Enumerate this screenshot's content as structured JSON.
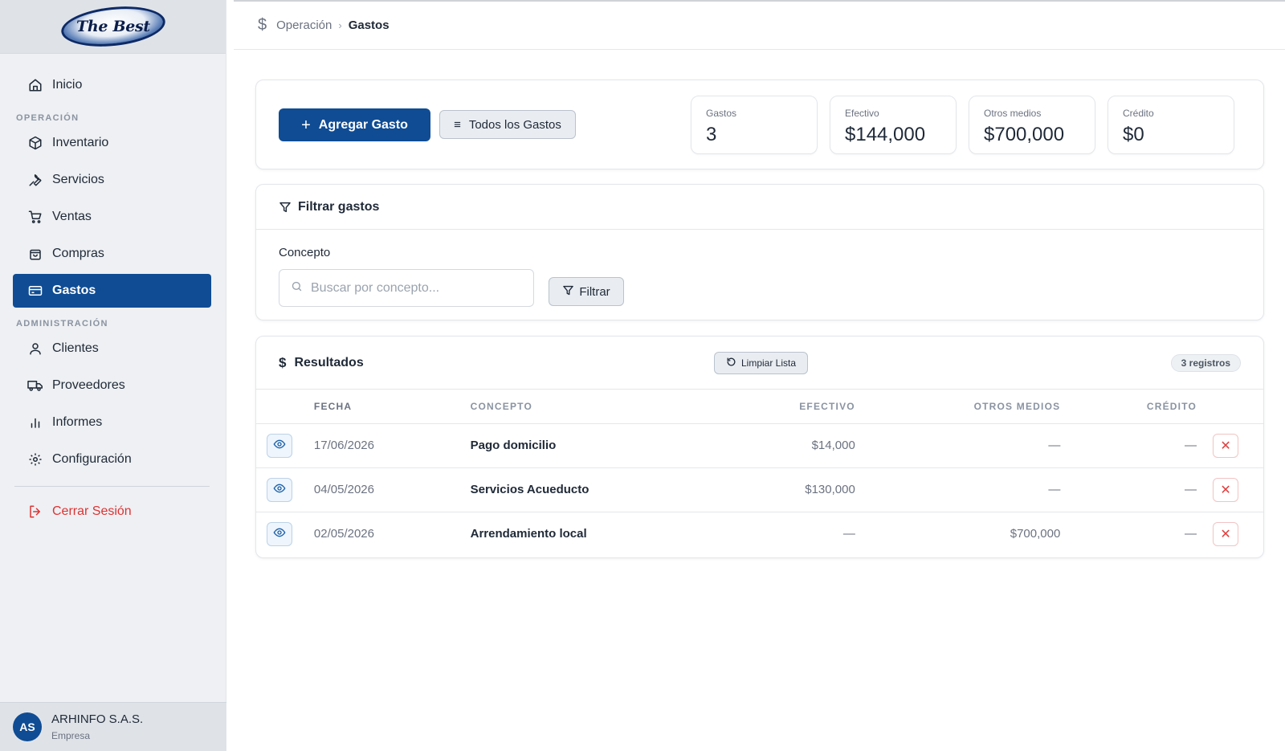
{
  "brand": {
    "logo_text": "The Best"
  },
  "sidebar": {
    "home": {
      "label": "Inicio",
      "icon": "home-icon"
    },
    "section_operacion": "OPERACIÓN",
    "operacion_items": [
      {
        "label": "Inventario",
        "icon": "box-icon"
      },
      {
        "label": "Servicios",
        "icon": "wrench-icon"
      },
      {
        "label": "Ventas",
        "icon": "cart-icon"
      },
      {
        "label": "Compras",
        "icon": "shopping-bag-icon"
      },
      {
        "label": "Gastos",
        "icon": "credit-card-icon",
        "active": true
      }
    ],
    "section_admin": "ADMINISTRACIÓN",
    "admin_items": [
      {
        "label": "Clientes",
        "icon": "user-icon"
      },
      {
        "label": "Proveedores",
        "icon": "truck-icon"
      },
      {
        "label": "Informes",
        "icon": "bar-chart-icon"
      },
      {
        "label": "Configuración",
        "icon": "gear-icon"
      }
    ],
    "logout": {
      "label": "Cerrar Sesión",
      "icon": "logout-icon"
    },
    "user": {
      "initials": "AS",
      "name": "ARHINFO S.A.S.",
      "role": "Empresa"
    }
  },
  "breadcrumb": {
    "icon": "dollar-icon",
    "parent": "Operación",
    "separator": "›",
    "current": "Gastos"
  },
  "actions": {
    "add_label": "Agregar Gasto",
    "all_label": "Todos los Gastos"
  },
  "stats": [
    {
      "label": "Gastos",
      "value": "3"
    },
    {
      "label": "Efectivo",
      "value": "$144,000"
    },
    {
      "label": "Otros medios",
      "value": "$700,000"
    },
    {
      "label": "Crédito",
      "value": "$0"
    }
  ],
  "filter": {
    "title": "Filtrar gastos",
    "field_label": "Concepto",
    "placeholder": "Buscar por concepto...",
    "button_label": "Filtrar"
  },
  "results": {
    "title": "Resultados",
    "clear_label": "Limpiar Lista",
    "count_badge": "3 registros",
    "columns": [
      "FECHA",
      "CONCEPTO",
      "EFECTIVO",
      "OTROS MEDIOS",
      "CRÉDITO"
    ],
    "rows": [
      {
        "fecha": "17/06/2026",
        "concepto": "Pago domicilio",
        "efectivo": "$14,000",
        "otros": "—",
        "credito": "—"
      },
      {
        "fecha": "04/05/2026",
        "concepto": "Servicios Acueducto",
        "efectivo": "$130,000",
        "otros": "—",
        "credito": "—"
      },
      {
        "fecha": "02/05/2026",
        "concepto": "Arrendamiento local",
        "efectivo": "—",
        "otros": "$700,000",
        "credito": "—"
      }
    ]
  },
  "colors": {
    "primary": "#0f4c94",
    "danger": "#e04040",
    "sidebar_bg": "#eef0f3"
  }
}
